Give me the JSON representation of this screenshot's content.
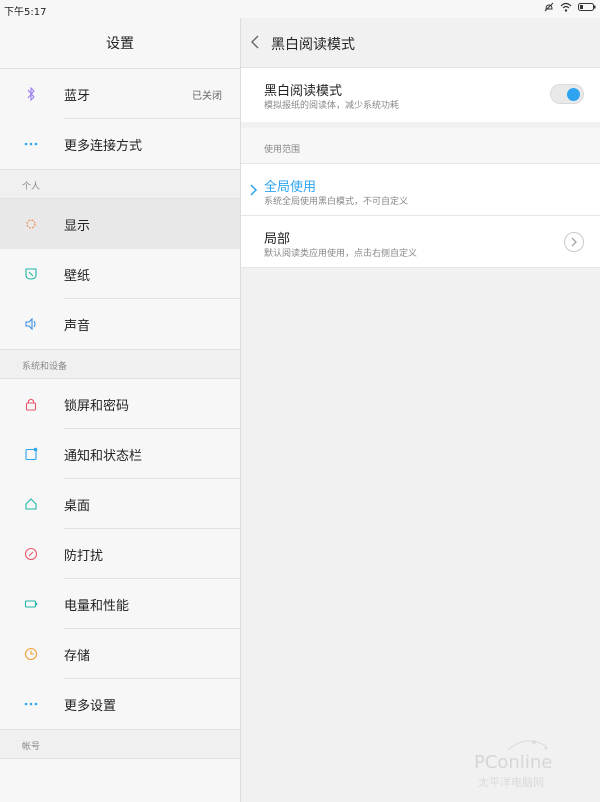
{
  "status_bar": {
    "time": "下午5:17"
  },
  "left_panel": {
    "title": "设置",
    "top_items": [
      {
        "label": "蓝牙",
        "value": "已关闭",
        "icon": "bluetooth-icon"
      },
      {
        "label": "更多连接方式",
        "icon": "more-dots-icon"
      }
    ],
    "section_personal": "个人",
    "personal_items": [
      {
        "label": "显示",
        "icon": "brightness-icon"
      },
      {
        "label": "壁纸",
        "icon": "wallpaper-icon"
      },
      {
        "label": "声音",
        "icon": "speaker-icon"
      }
    ],
    "section_system": "系统和设备",
    "system_items": [
      {
        "label": "锁屏和密码",
        "icon": "lock-icon"
      },
      {
        "label": "通知和状态栏",
        "icon": "notification-icon"
      },
      {
        "label": "桌面",
        "icon": "home-icon"
      },
      {
        "label": "防打扰",
        "icon": "do-not-disturb-icon"
      },
      {
        "label": "电量和性能",
        "icon": "battery-icon"
      },
      {
        "label": "存储",
        "icon": "storage-icon"
      },
      {
        "label": "更多设置",
        "icon": "more-dots-icon"
      }
    ],
    "section_account": "帐号"
  },
  "right_panel": {
    "title": "黑白阅读模式",
    "mode_row": {
      "title": "黑白阅读模式",
      "subtitle": "模拟报纸的阅读体，减少系统功耗",
      "enabled": true
    },
    "scope_label": "使用范围",
    "global_row": {
      "title": "全局使用",
      "subtitle": "系统全局使用黑白模式，不可自定义",
      "selected": true
    },
    "partial_row": {
      "title": "局部",
      "subtitle": "默认阅读类应用使用，点击右侧自定义"
    }
  },
  "watermark": {
    "text": "PConline",
    "subtext": "太平洋电脑网"
  },
  "colors": {
    "accent": "#2ea4f1",
    "background": "#f1f1f1"
  }
}
